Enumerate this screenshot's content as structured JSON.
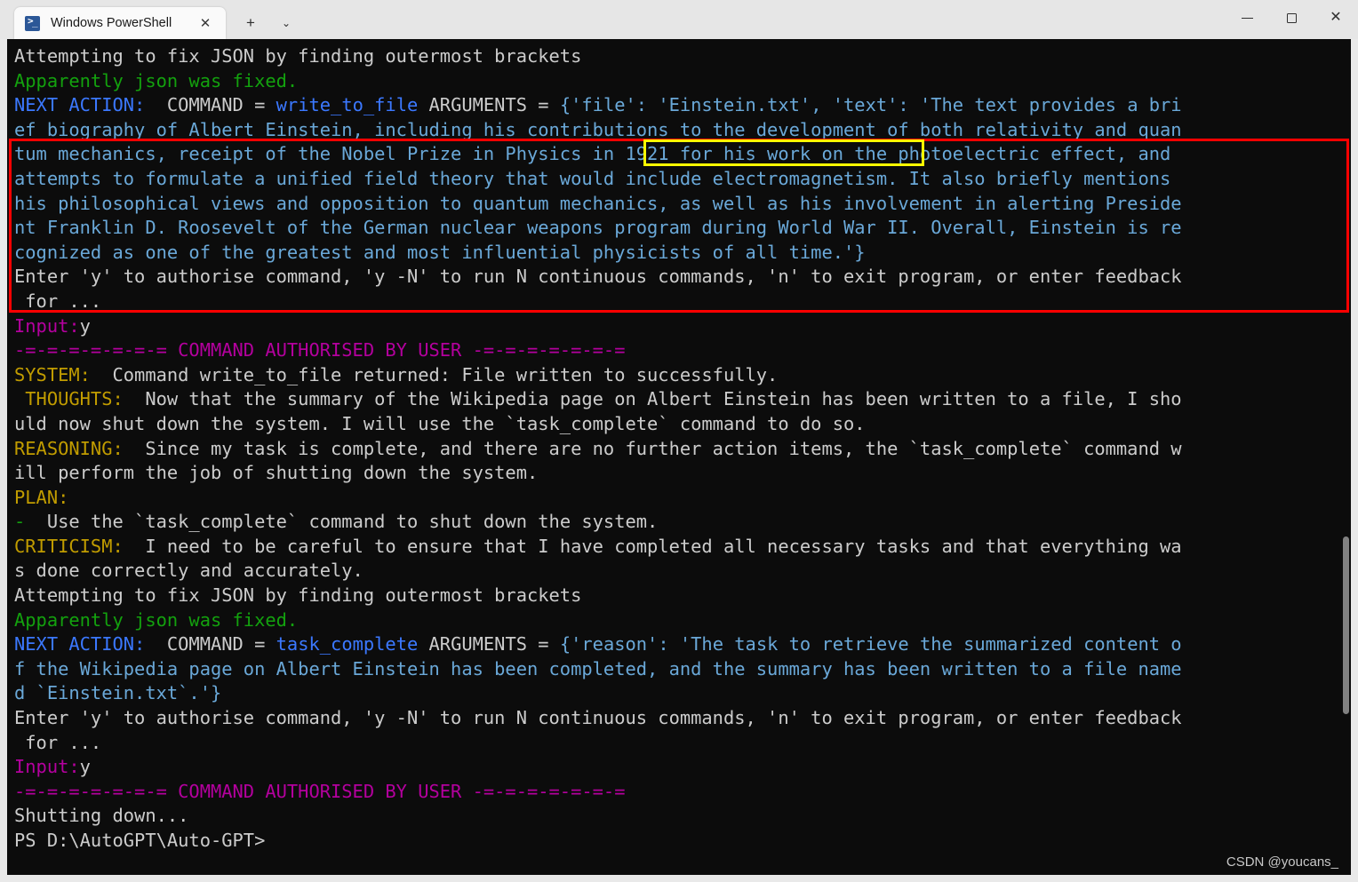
{
  "window": {
    "controls": {
      "minimize_label": "—",
      "maximize_label": "□",
      "close_label": "✕"
    }
  },
  "tabbar": {
    "tabs": [
      {
        "title": "Windows PowerShell",
        "close_label": "✕",
        "icon": "powershell-icon"
      }
    ],
    "new_tab_label": "+",
    "dropdown_label": "⌄"
  },
  "terminal": {
    "prompt": "PS D:\\AutoGPT\\Auto-GPT>",
    "lines": [
      {
        "segs": [
          {
            "t": "Attempting to fix JSON by finding outermost brackets",
            "c": "c-white"
          }
        ]
      },
      {
        "segs": [
          {
            "t": "Apparently json was fixed.",
            "c": "c-green"
          }
        ]
      },
      {
        "segs": [
          {
            "t": "NEXT ACTION:",
            "c": "c-blue"
          },
          {
            "t": "  COMMAND = ",
            "c": "c-white"
          },
          {
            "t": "write_to_file",
            "c": "c-blue"
          },
          {
            "t": " ARGUMENTS = ",
            "c": "c-white"
          },
          {
            "t": "{'file': 'Einstein.txt', 'text': 'The text provides a bri",
            "c": "c-argblue"
          }
        ]
      },
      {
        "segs": [
          {
            "t": "ef biography of Albert Einstein, including his contributions to the development of both relativity and quan",
            "c": "c-argblue"
          }
        ]
      },
      {
        "segs": [
          {
            "t": "tum mechanics, receipt of the Nobel Prize in Physics in 1921 for his work on the photoelectric effect, and",
            "c": "c-argblue"
          }
        ]
      },
      {
        "segs": [
          {
            "t": "attempts to formulate a unified field theory that would include electromagnetism. It also briefly mentions",
            "c": "c-argblue"
          }
        ]
      },
      {
        "segs": [
          {
            "t": "his philosophical views and opposition to quantum mechanics, as well as his involvement in alerting Preside",
            "c": "c-argblue"
          }
        ]
      },
      {
        "segs": [
          {
            "t": "nt Franklin D. Roosevelt of the German nuclear weapons program during World War II. Overall, Einstein is re",
            "c": "c-argblue"
          }
        ]
      },
      {
        "segs": [
          {
            "t": "cognized as one of the greatest and most influential physicists of all time.'}",
            "c": "c-argblue"
          }
        ]
      },
      {
        "segs": [
          {
            "t": "Enter 'y' to authorise command, 'y -N' to run N continuous commands, 'n' to exit program, or enter feedback",
            "c": "c-white"
          }
        ]
      },
      {
        "segs": [
          {
            "t": " for ...",
            "c": "c-white"
          }
        ]
      },
      {
        "segs": [
          {
            "t": "Input:",
            "c": "c-magenta"
          },
          {
            "t": "y",
            "c": "c-white"
          }
        ]
      },
      {
        "segs": [
          {
            "t": "-=-=-=-=-=-=-= COMMAND AUTHORISED BY USER -=-=-=-=-=-=-=",
            "c": "c-magenta"
          }
        ]
      },
      {
        "segs": [
          {
            "t": "SYSTEM:",
            "c": "c-yellow"
          },
          {
            "t": "  Command write_to_file returned: File written to successfully.",
            "c": "c-white"
          }
        ]
      },
      {
        "segs": [
          {
            "t": " THOUGHTS:",
            "c": "c-yellow"
          },
          {
            "t": "  Now that the summary of the Wikipedia page on Albert Einstein has been written to a file, I sho",
            "c": "c-white"
          }
        ]
      },
      {
        "segs": [
          {
            "t": "uld now shut down the system. I will use the `task_complete` command to do so.",
            "c": "c-white"
          }
        ]
      },
      {
        "segs": [
          {
            "t": "REASONING:",
            "c": "c-yellow"
          },
          {
            "t": "  Since my task is complete, and there are no further action items, the `task_complete` command w",
            "c": "c-white"
          }
        ]
      },
      {
        "segs": [
          {
            "t": "ill perform the job of shutting down the system.",
            "c": "c-white"
          }
        ]
      },
      {
        "segs": [
          {
            "t": "PLAN:",
            "c": "c-yellow"
          }
        ]
      },
      {
        "segs": [
          {
            "t": "-",
            "c": "c-green"
          },
          {
            "t": "  Use the `task_complete` command to shut down the system.",
            "c": "c-white"
          }
        ]
      },
      {
        "segs": [
          {
            "t": "CRITICISM:",
            "c": "c-yellow"
          },
          {
            "t": "  I need to be careful to ensure that I have completed all necessary tasks and that everything wa",
            "c": "c-white"
          }
        ]
      },
      {
        "segs": [
          {
            "t": "s done correctly and accurately.",
            "c": "c-white"
          }
        ]
      },
      {
        "segs": [
          {
            "t": "Attempting to fix JSON by finding outermost brackets",
            "c": "c-white"
          }
        ]
      },
      {
        "segs": [
          {
            "t": "Apparently json was fixed.",
            "c": "c-green"
          }
        ]
      },
      {
        "segs": [
          {
            "t": "NEXT ACTION:",
            "c": "c-blue"
          },
          {
            "t": "  COMMAND = ",
            "c": "c-white"
          },
          {
            "t": "task_complete",
            "c": "c-blue"
          },
          {
            "t": " ARGUMENTS = ",
            "c": "c-white"
          },
          {
            "t": "{'reason': 'The task to retrieve the summarized content o",
            "c": "c-argblue"
          }
        ]
      },
      {
        "segs": [
          {
            "t": "f the Wikipedia page on Albert Einstein has been completed, and the summary has been written to a file name",
            "c": "c-argblue"
          }
        ]
      },
      {
        "segs": [
          {
            "t": "d `Einstein.txt`.'}",
            "c": "c-argblue"
          }
        ]
      },
      {
        "segs": [
          {
            "t": "Enter 'y' to authorise command, 'y -N' to run N continuous commands, 'n' to exit program, or enter feedback",
            "c": "c-white"
          }
        ]
      },
      {
        "segs": [
          {
            "t": " for ...",
            "c": "c-white"
          }
        ]
      },
      {
        "segs": [
          {
            "t": "Input:",
            "c": "c-magenta"
          },
          {
            "t": "y",
            "c": "c-white"
          }
        ]
      },
      {
        "segs": [
          {
            "t": "-=-=-=-=-=-=-= COMMAND AUTHORISED BY USER -=-=-=-=-=-=-=",
            "c": "c-magenta"
          }
        ]
      },
      {
        "segs": [
          {
            "t": "Shutting down...",
            "c": "c-white"
          }
        ]
      },
      {
        "segs": [
          {
            "t": "PS D:\\AutoGPT\\Auto-GPT>",
            "c": "c-white"
          }
        ]
      }
    ]
  },
  "annotations": {
    "red_box_label": "next-action-highlight",
    "yellow_box_label": "file-argument-highlight",
    "red_color": "#ff0000",
    "yellow_color": "#ffff00"
  },
  "watermark": {
    "text": "CSDN @youcans_"
  }
}
